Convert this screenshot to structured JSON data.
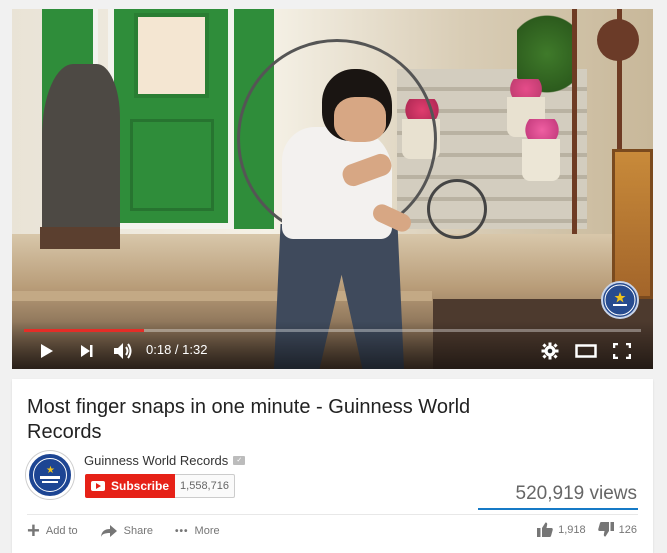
{
  "player": {
    "current_time": "0:18",
    "separator": " / ",
    "duration": "1:32",
    "progress_fraction": 0.195,
    "watermark_text": "GUINNESS WORLD RECORDS",
    "accent_color": "#e52d27"
  },
  "video": {
    "title": "Most finger snaps in one minute - Guinness World Records"
  },
  "channel": {
    "name": "Guinness World Records",
    "subscribe_label": "Subscribe",
    "subscriber_count": "1,558,716",
    "logo_text": "GUINNESS WORLD RECORDS"
  },
  "stats": {
    "views": "520,919 views",
    "likes": "1,918",
    "dislikes": "126"
  },
  "actions": {
    "add_to": "Add to",
    "share": "Share",
    "more": "More"
  },
  "icons": {
    "play": "play-icon",
    "next": "next-icon",
    "volume": "volume-icon",
    "settings": "gear-icon",
    "theater": "theater-mode-icon",
    "fullscreen": "fullscreen-icon",
    "verified": "verified-icon",
    "add": "plus-icon",
    "share": "share-arrow-icon",
    "more": "dots-icon",
    "like": "thumbs-up-icon",
    "dislike": "thumbs-down-icon"
  }
}
